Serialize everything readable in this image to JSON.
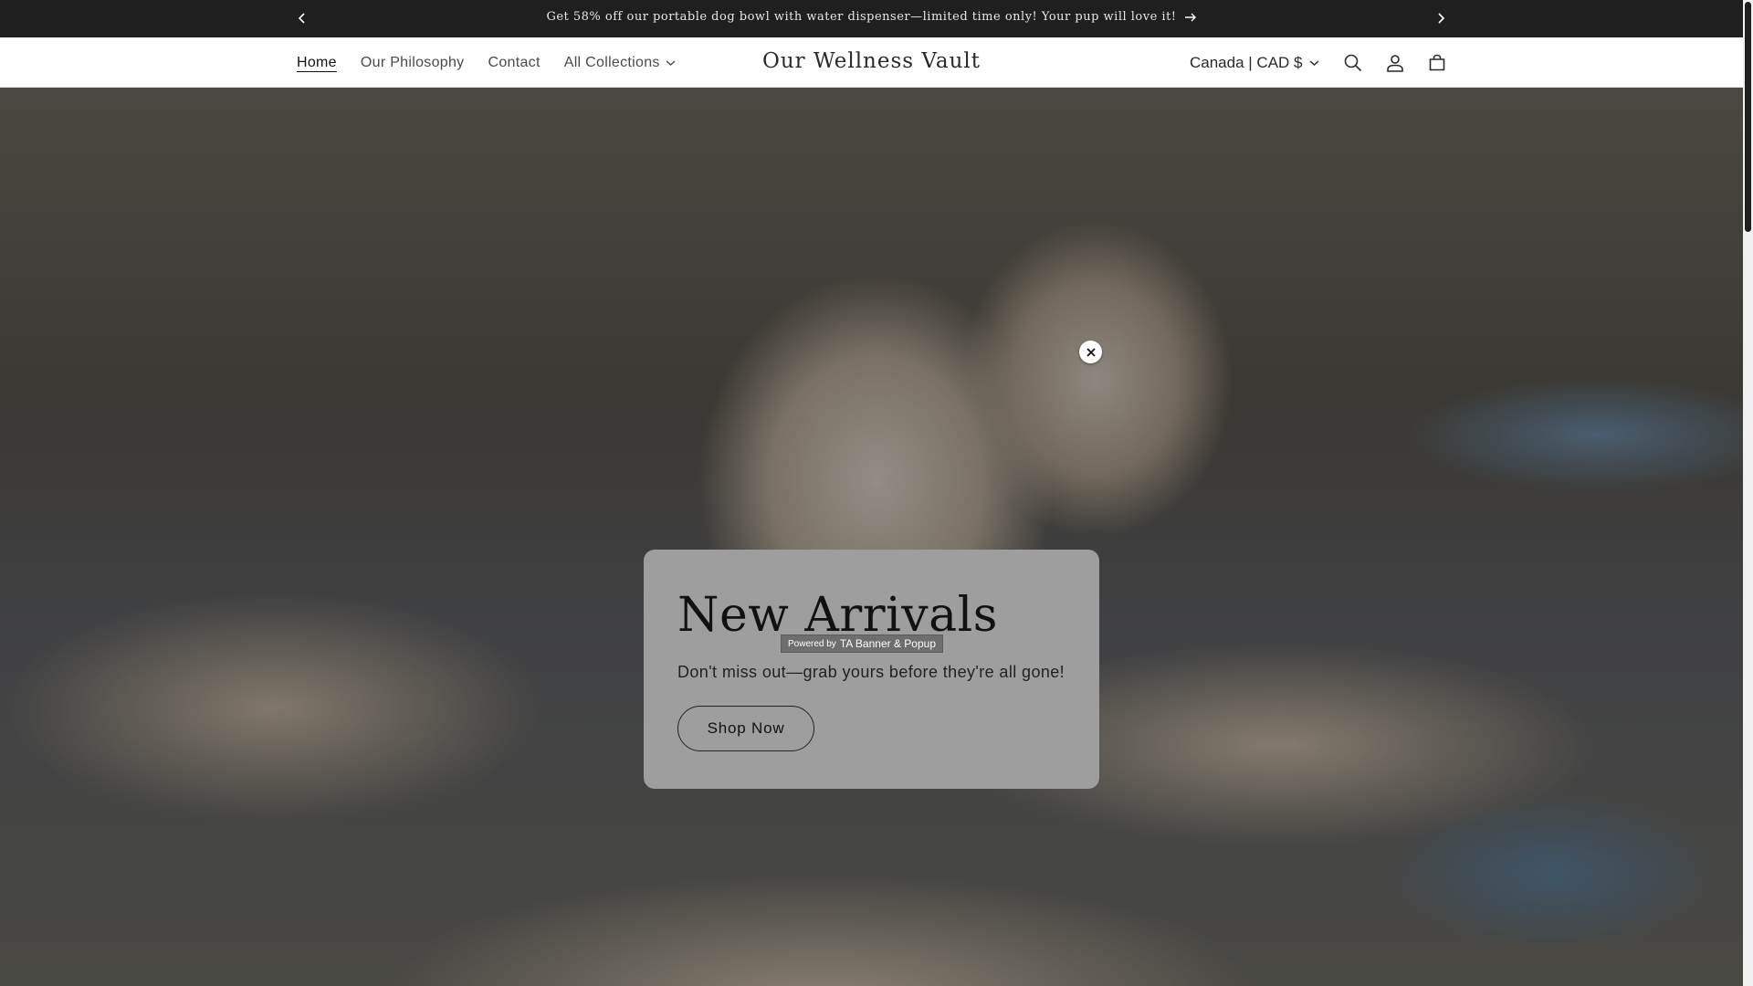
{
  "announcement": {
    "text": "Get 58% off our portable dog bowl with water dispenser—limited time only! Your pup will love it!",
    "prev_icon": "chevron-left-icon",
    "next_icon": "chevron-right-icon",
    "link_icon": "arrow-right-icon"
  },
  "header": {
    "brand": "Our Wellness Vault",
    "nav": [
      {
        "label": "Home",
        "active": true
      },
      {
        "label": "Our Philosophy"
      },
      {
        "label": "Contact"
      },
      {
        "label": "All Collections",
        "has_dropdown": true
      }
    ],
    "currency": "Canada | CAD $",
    "icons": [
      "search-icon",
      "account-icon",
      "cart-icon"
    ]
  },
  "popup": {
    "title": "New Arrivals",
    "powered_prefix": "Powered by",
    "powered_brand": "TA Banner & Popup",
    "subtitle": "Don't miss out—grab yours before they're all gone!",
    "button_label": "Shop Now",
    "close_icon": "close-icon"
  },
  "colors": {
    "announcement_bg": "#1f1f1f",
    "header_bg": "#ffffff",
    "popup_bg": "#9e9e9e",
    "text_dark": "#121212"
  }
}
